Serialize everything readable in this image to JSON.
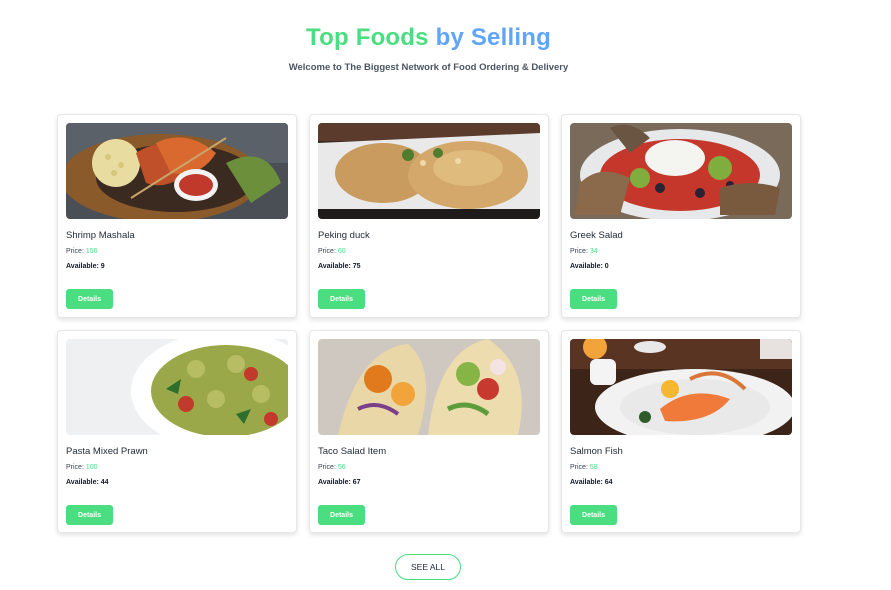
{
  "header": {
    "title_part1": "Top Foods",
    "title_part2": "by Selling",
    "subtitle": "Welcome to The Biggest Network of Food Ordering & Delivery"
  },
  "labels": {
    "price": "Price:",
    "available": "Available:",
    "details": "Details"
  },
  "foods": [
    {
      "name": "Shrimp Mashala",
      "price": "156",
      "available": "9"
    },
    {
      "name": "Peking duck",
      "price": "60",
      "available": "75"
    },
    {
      "name": "Greek Salad",
      "price": "34",
      "available": "0"
    },
    {
      "name": "Pasta Mixed Prawn",
      "price": "100",
      "available": "44"
    },
    {
      "name": "Taco Salad Item",
      "price": "56",
      "available": "67"
    },
    {
      "name": "Salmon Fish",
      "price": "58",
      "available": "64"
    }
  ],
  "see_all_label": "SEE ALL",
  "colors": {
    "accent_green": "#4ade80",
    "accent_blue": "#60a5fa"
  }
}
